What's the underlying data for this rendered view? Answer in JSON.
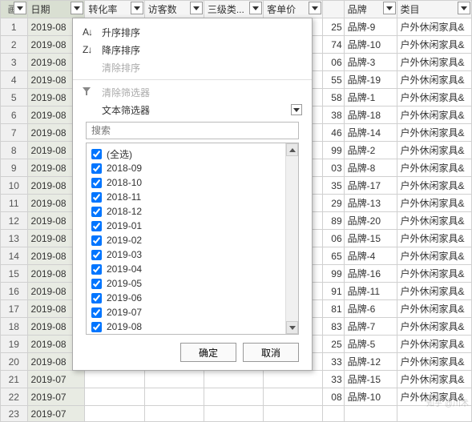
{
  "headers": {
    "rowhead": "画.",
    "date": "日期",
    "rate": "转化率",
    "visitors": "访客数",
    "cat3": "三级类...",
    "price": "客单价",
    "brand": "品牌",
    "class": "类目"
  },
  "rows": [
    {
      "n": "1",
      "date": "2019-08",
      "num": "25",
      "brand": "品牌-9",
      "class": "户外休闲家具&"
    },
    {
      "n": "2",
      "date": "2019-08",
      "num": "74",
      "brand": "品牌-10",
      "class": "户外休闲家具&"
    },
    {
      "n": "3",
      "date": "2019-08",
      "num": "06",
      "brand": "品牌-3",
      "class": "户外休闲家具&"
    },
    {
      "n": "4",
      "date": "2019-08",
      "num": "55",
      "brand": "品牌-19",
      "class": "户外休闲家具&"
    },
    {
      "n": "5",
      "date": "2019-08",
      "num": "58",
      "brand": "品牌-1",
      "class": "户外休闲家具&"
    },
    {
      "n": "6",
      "date": "2019-08",
      "num": "38",
      "brand": "品牌-18",
      "class": "户外休闲家具&"
    },
    {
      "n": "7",
      "date": "2019-08",
      "num": "46",
      "brand": "品牌-14",
      "class": "户外休闲家具&"
    },
    {
      "n": "8",
      "date": "2019-08",
      "num": "99",
      "brand": "品牌-2",
      "class": "户外休闲家具&"
    },
    {
      "n": "9",
      "date": "2019-08",
      "num": "03",
      "brand": "品牌-8",
      "class": "户外休闲家具&"
    },
    {
      "n": "10",
      "date": "2019-08",
      "num": "35",
      "brand": "品牌-17",
      "class": "户外休闲家具&"
    },
    {
      "n": "11",
      "date": "2019-08",
      "num": "29",
      "brand": "品牌-13",
      "class": "户外休闲家具&"
    },
    {
      "n": "12",
      "date": "2019-08",
      "num": "89",
      "brand": "品牌-20",
      "class": "户外休闲家具&"
    },
    {
      "n": "13",
      "date": "2019-08",
      "num": "06",
      "brand": "品牌-15",
      "class": "户外休闲家具&"
    },
    {
      "n": "14",
      "date": "2019-08",
      "num": "65",
      "brand": "品牌-4",
      "class": "户外休闲家具&"
    },
    {
      "n": "15",
      "date": "2019-08",
      "num": "99",
      "brand": "品牌-16",
      "class": "户外休闲家具&"
    },
    {
      "n": "16",
      "date": "2019-08",
      "num": "91",
      "brand": "品牌-11",
      "class": "户外休闲家具&"
    },
    {
      "n": "17",
      "date": "2019-08",
      "num": "81",
      "brand": "品牌-6",
      "class": "户外休闲家具&"
    },
    {
      "n": "18",
      "date": "2019-08",
      "num": "83",
      "brand": "品牌-7",
      "class": "户外休闲家具&"
    },
    {
      "n": "19",
      "date": "2019-08",
      "num": "25",
      "brand": "品牌-5",
      "class": "户外休闲家具&"
    },
    {
      "n": "20",
      "date": "2019-08",
      "num": "33",
      "brand": "品牌-12",
      "class": "户外休闲家具&"
    },
    {
      "n": "21",
      "date": "2019-07",
      "num": "33",
      "brand": "品牌-15",
      "class": "户外休闲家具&"
    },
    {
      "n": "22",
      "date": "2019-07",
      "num": "08",
      "brand": "品牌-10",
      "class": "户外休闲家具&"
    },
    {
      "n": "23",
      "date": "2019-07",
      "num": "",
      "brand": "",
      "class": ""
    }
  ],
  "menu": {
    "sortAsc": "升序排序",
    "sortDesc": "降序排序",
    "clearSort": "清除排序",
    "clearFilter": "清除筛选器",
    "textFilter": "文本筛选器",
    "searchPlaceholder": "搜索",
    "selectAll": "(全选)",
    "items": [
      "2018-09",
      "2018-10",
      "2018-11",
      "2018-12",
      "2019-01",
      "2019-02",
      "2019-03",
      "2019-04",
      "2019-05",
      "2019-06",
      "2019-07",
      "2019-08"
    ],
    "highlightItem": "日期",
    "ok": "确定",
    "cancel": "取消"
  },
  "watermark": "知乎 @川术"
}
